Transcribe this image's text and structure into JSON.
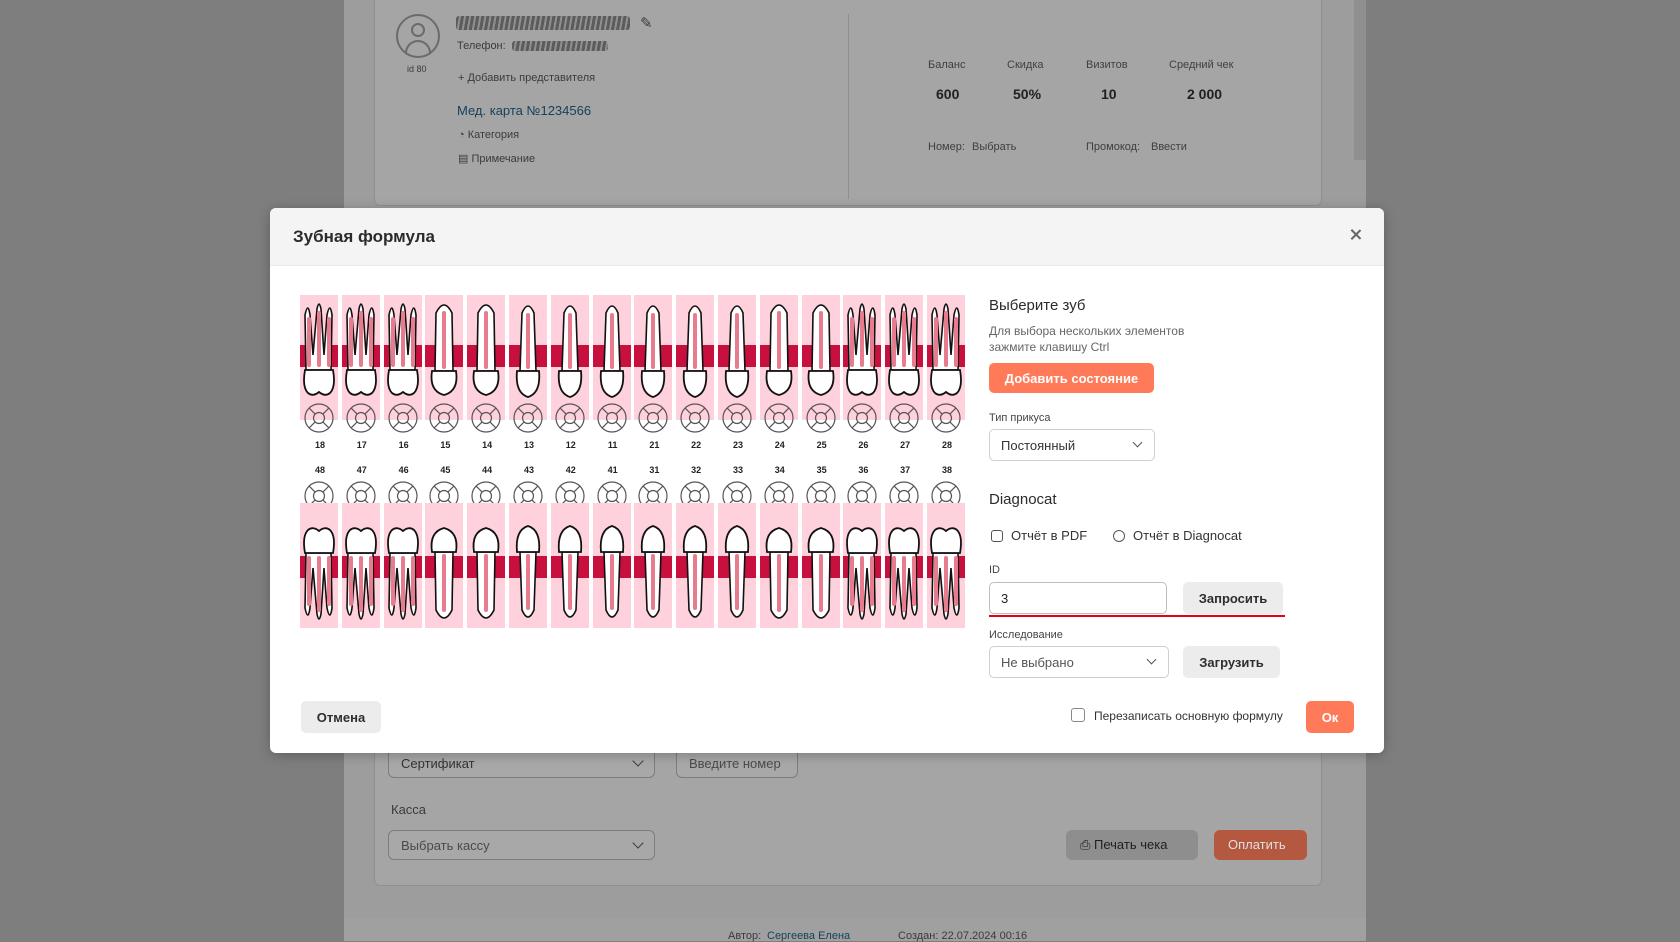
{
  "background": {
    "patient_id": "id 80",
    "phone_label": "Телефон:",
    "add_representative": "+ Добавить представителя",
    "med_card": "Мед. карта №1234566",
    "category": "Категория",
    "note": "Примечание",
    "stats": [
      {
        "label": "Баланс",
        "value": "600"
      },
      {
        "label": "Скидка",
        "value": "50%"
      },
      {
        "label": "Визитов",
        "value": "10"
      },
      {
        "label": "Средний чек",
        "value": "2 000"
      }
    ],
    "number_label": "Номер:",
    "number_link": "Выбрать",
    "promo_label": "Промокод:",
    "promo_link": "Ввести",
    "certificate_select": "Сертификат",
    "number_placeholder": "Введите номер",
    "cash_label": "Касса",
    "cash_select": "Выбрать кассу",
    "print_receipt": "Печать чека",
    "pay": "Оплатить",
    "author_label": "Автор:",
    "author_name": "Сергеева Елена",
    "created": "Создан: 22.07.2024 00:16"
  },
  "modal": {
    "title": "Зубная формула",
    "upper_teeth": [
      "18",
      "17",
      "16",
      "15",
      "14",
      "13",
      "12",
      "11",
      "21",
      "22",
      "23",
      "24",
      "25",
      "26",
      "27",
      "28"
    ],
    "lower_teeth": [
      "48",
      "47",
      "46",
      "45",
      "44",
      "43",
      "42",
      "41",
      "31",
      "32",
      "33",
      "34",
      "35",
      "36",
      "37",
      "38"
    ],
    "select_tooth_title": "Выберите зуб",
    "select_hint_line1": "Для выбора нескольких элементов",
    "select_hint_line2": "зажмите клавишу Ctrl",
    "add_state_button": "Добавить состояние",
    "bite_type_label": "Тип прикуса",
    "bite_type_value": "Постоянный",
    "diagnocat_title": "Diagnocat",
    "report_pdf": "Отчёт в PDF",
    "report_diagnocat": "Отчёт в Diagnocat",
    "id_label": "ID",
    "id_value": "3",
    "request_button": "Запросить",
    "study_label": "Исследование",
    "study_value": "Не выбрано",
    "load_button": "Загрузить",
    "cancel_button": "Отмена",
    "overwrite_label": "Перезаписать основную формулу",
    "ok_button": "Ок",
    "colors": {
      "accent": "#ff7a59",
      "tooth_bg": "#ffd1dc",
      "gum_band": "#c8103e",
      "underline": "#e2001a"
    }
  }
}
